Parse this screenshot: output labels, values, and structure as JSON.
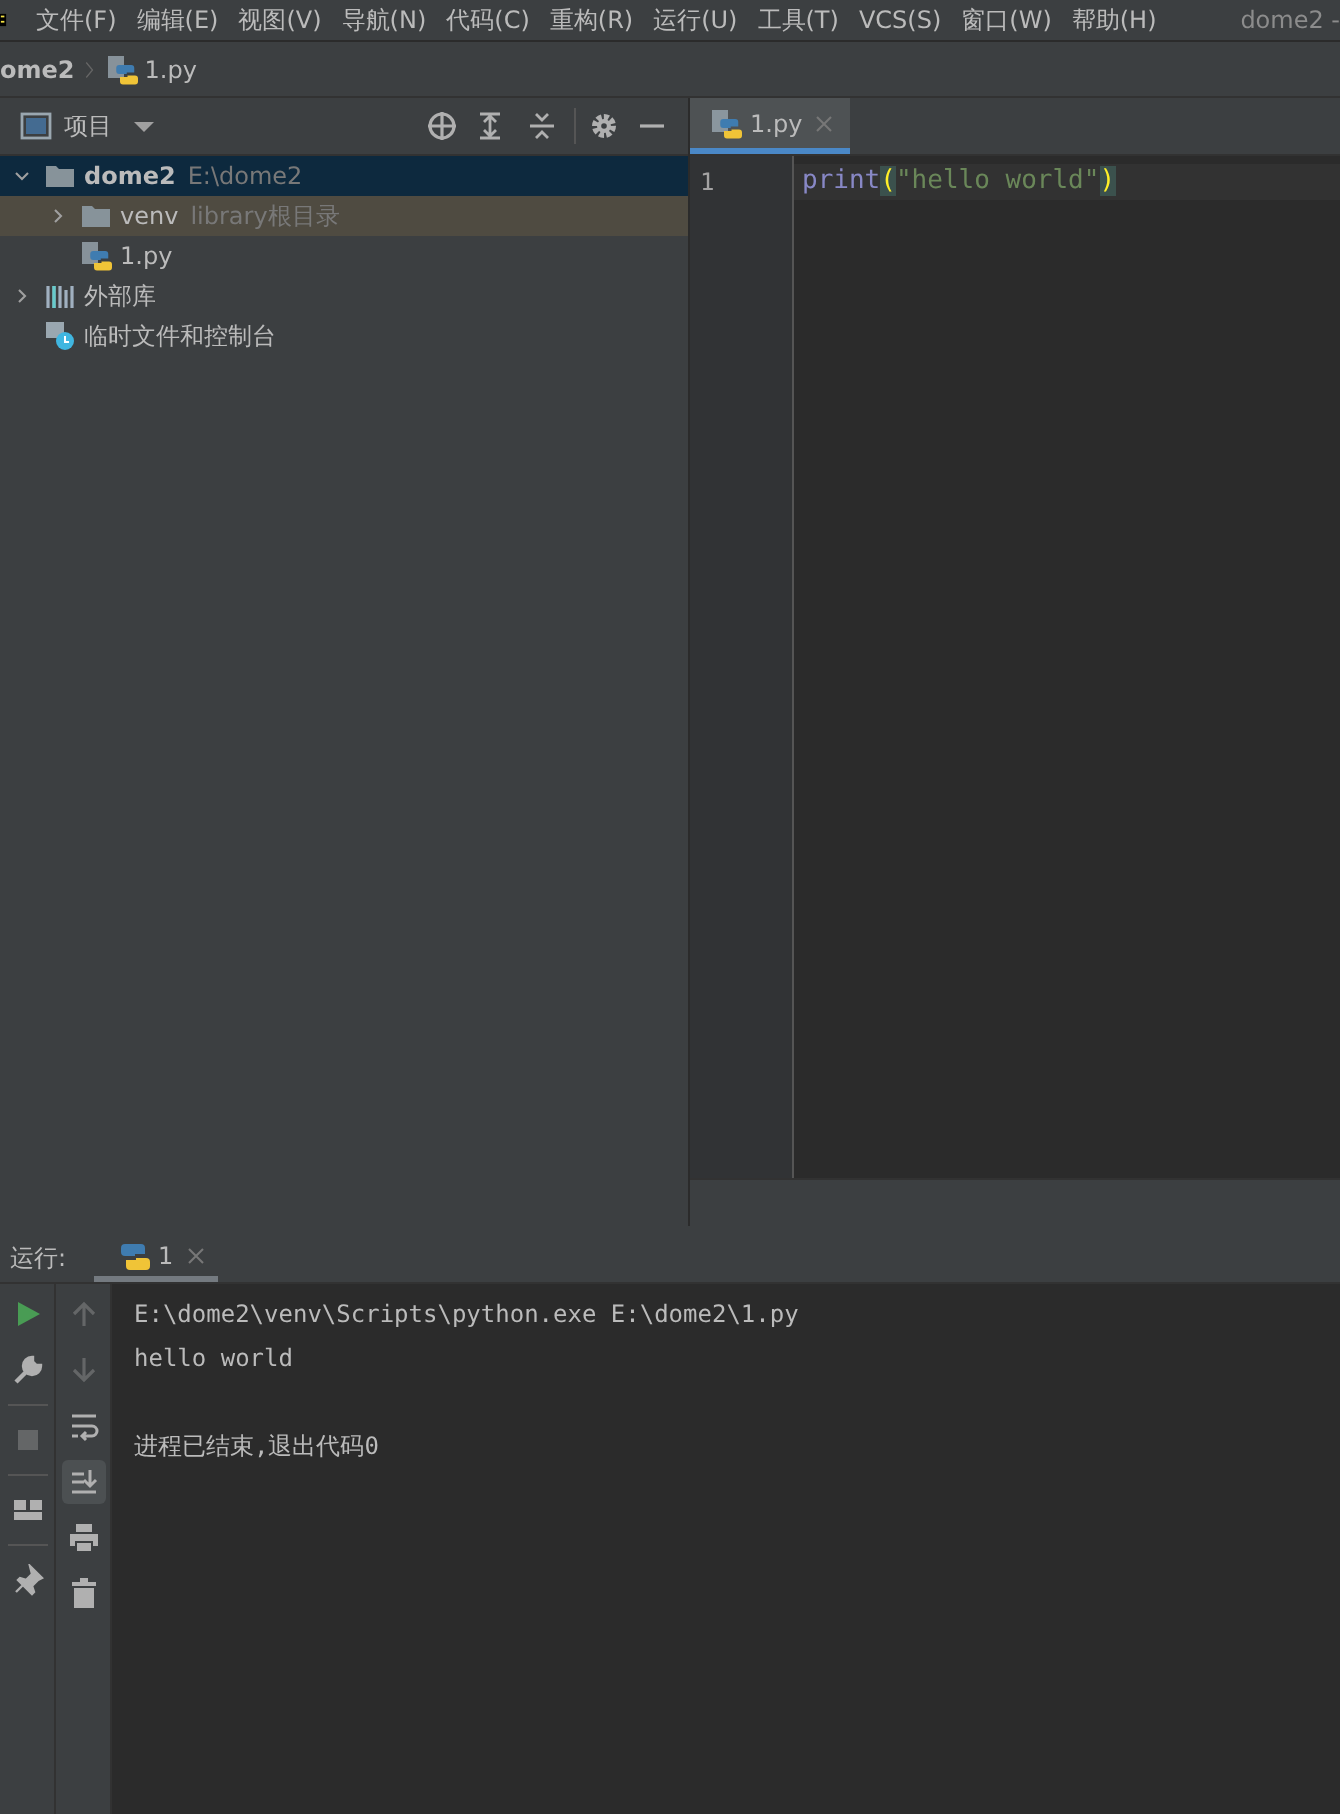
{
  "menu_bar": {
    "items": [
      "文件(F)",
      "编辑(E)",
      "视图(V)",
      "导航(N)",
      "代码(C)",
      "重构(R)",
      "运行(U)",
      "工具(T)",
      "VCS(S)",
      "窗口(W)",
      "帮助(H)"
    ],
    "title": "dome2 -"
  },
  "breadcrumb": [
    "ome2",
    "1.py"
  ],
  "project_panel": {
    "title": "项目",
    "tree": [
      {
        "label": "dome2",
        "hint": "E:\\dome2",
        "kind": "project",
        "expanded": true,
        "selected": true,
        "children": [
          {
            "label": "venv",
            "hint": "library根目录",
            "kind": "library-root",
            "expanded": false,
            "selected": false
          },
          {
            "label": "1.py",
            "kind": "python-file",
            "selected": false
          }
        ]
      },
      {
        "label": "外部库",
        "kind": "libraries",
        "expanded": false,
        "selected": false
      },
      {
        "label": "临时文件和控制台",
        "kind": "scratches",
        "selected": false
      }
    ]
  },
  "editor": {
    "tabs": [
      {
        "label": "1.py",
        "selected": true
      }
    ],
    "lines": [
      {
        "number": "1",
        "tokens": [
          {
            "text": "print",
            "kind": "builtin"
          },
          {
            "text": "(",
            "kind": "paren-match"
          },
          {
            "text": "\"hello world\"",
            "kind": "string"
          },
          {
            "text": ")",
            "kind": "paren-match"
          }
        ]
      }
    ]
  },
  "run_panel": {
    "label": "运行:",
    "tabs": [
      {
        "label": "1",
        "selected": true
      }
    ],
    "left_tools": [
      {
        "kind": "run",
        "disabled": false
      },
      {
        "kind": "wrench",
        "disabled": false
      },
      {
        "kind": "stop",
        "disabled": true
      },
      {
        "kind": "layout",
        "disabled": false
      },
      {
        "kind": "pin",
        "disabled": false
      }
    ],
    "side_tools": [
      {
        "kind": "up",
        "disabled": true,
        "selected": false
      },
      {
        "kind": "down",
        "disabled": true,
        "selected": false
      },
      {
        "kind": "wrap",
        "disabled": false,
        "selected": false
      },
      {
        "kind": "scroll-end",
        "disabled": false,
        "selected": true
      },
      {
        "kind": "print",
        "disabled": false,
        "selected": false
      },
      {
        "kind": "trash",
        "disabled": false,
        "selected": false
      }
    ],
    "output": [
      {
        "text": "E:\\dome2\\venv\\Scripts\\python.exe E:\\dome2\\1.py",
        "kind": "command"
      },
      {
        "text": "hello world",
        "kind": "stdout"
      },
      {
        "text": "进程已结束,退出代码0",
        "kind": "status"
      }
    ]
  }
}
